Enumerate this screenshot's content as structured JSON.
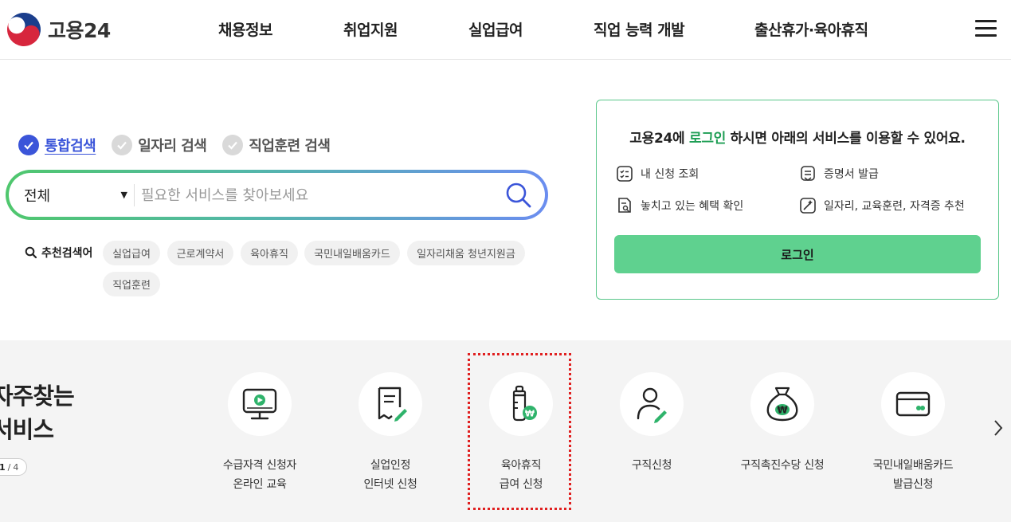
{
  "header": {
    "logo_text": "고용24",
    "nav": [
      "채용정보",
      "취업지원",
      "실업급여",
      "직업 능력 개발",
      "출산휴가·육아휴직"
    ]
  },
  "search": {
    "tabs": [
      {
        "label": "통합검색",
        "selected": true
      },
      {
        "label": "일자리 검색",
        "selected": false
      },
      {
        "label": "직업훈련 검색",
        "selected": false
      }
    ],
    "scope": "전체",
    "placeholder": "필요한 서비스를 찾아보세요",
    "reco_title": "추천검색어",
    "keywords": [
      "실업급여",
      "근로계약서",
      "육아휴직",
      "국민내일배움카드",
      "일자리채움 청년지원금",
      "직업훈련"
    ]
  },
  "login": {
    "msg_pre": "고용24에 ",
    "msg_hl": "로그인",
    "msg_post": " 하시면 아래의 서비스를 이용할 수 있어요.",
    "services": [
      "내 신청 조회",
      "증명서 발급",
      "놓치고 있는 혜택 확인",
      "일자리, 교육훈련, 자격증 추천"
    ],
    "button": "로그인"
  },
  "frequent": {
    "title_line1": "자주찾는",
    "title_line2": "서비스",
    "page_current": "1",
    "page_sep": " / ",
    "page_total": "4",
    "items": [
      {
        "line1": "수급자격 신청자",
        "line2": "온라인 교육",
        "icon": "monitor-play-icon"
      },
      {
        "line1": "실업인정",
        "line2": "인터넷 신청",
        "icon": "document-pen-icon"
      },
      {
        "line1": "육아휴직",
        "line2": "급여 신청",
        "icon": "baby-bottle-won-icon"
      },
      {
        "line1": "구직신청",
        "line2": "",
        "icon": "person-pen-icon"
      },
      {
        "line1": "구직촉진수당 신청",
        "line2": "",
        "icon": "money-bag-icon"
      },
      {
        "line1": "국민내일배움카드",
        "line2": "발급신청",
        "icon": "card-icon"
      }
    ]
  },
  "colors": {
    "accent_blue": "#3b55d9",
    "accent_green": "#1e9e54",
    "login_button": "#5fd18f",
    "highlight": "#e02020"
  }
}
